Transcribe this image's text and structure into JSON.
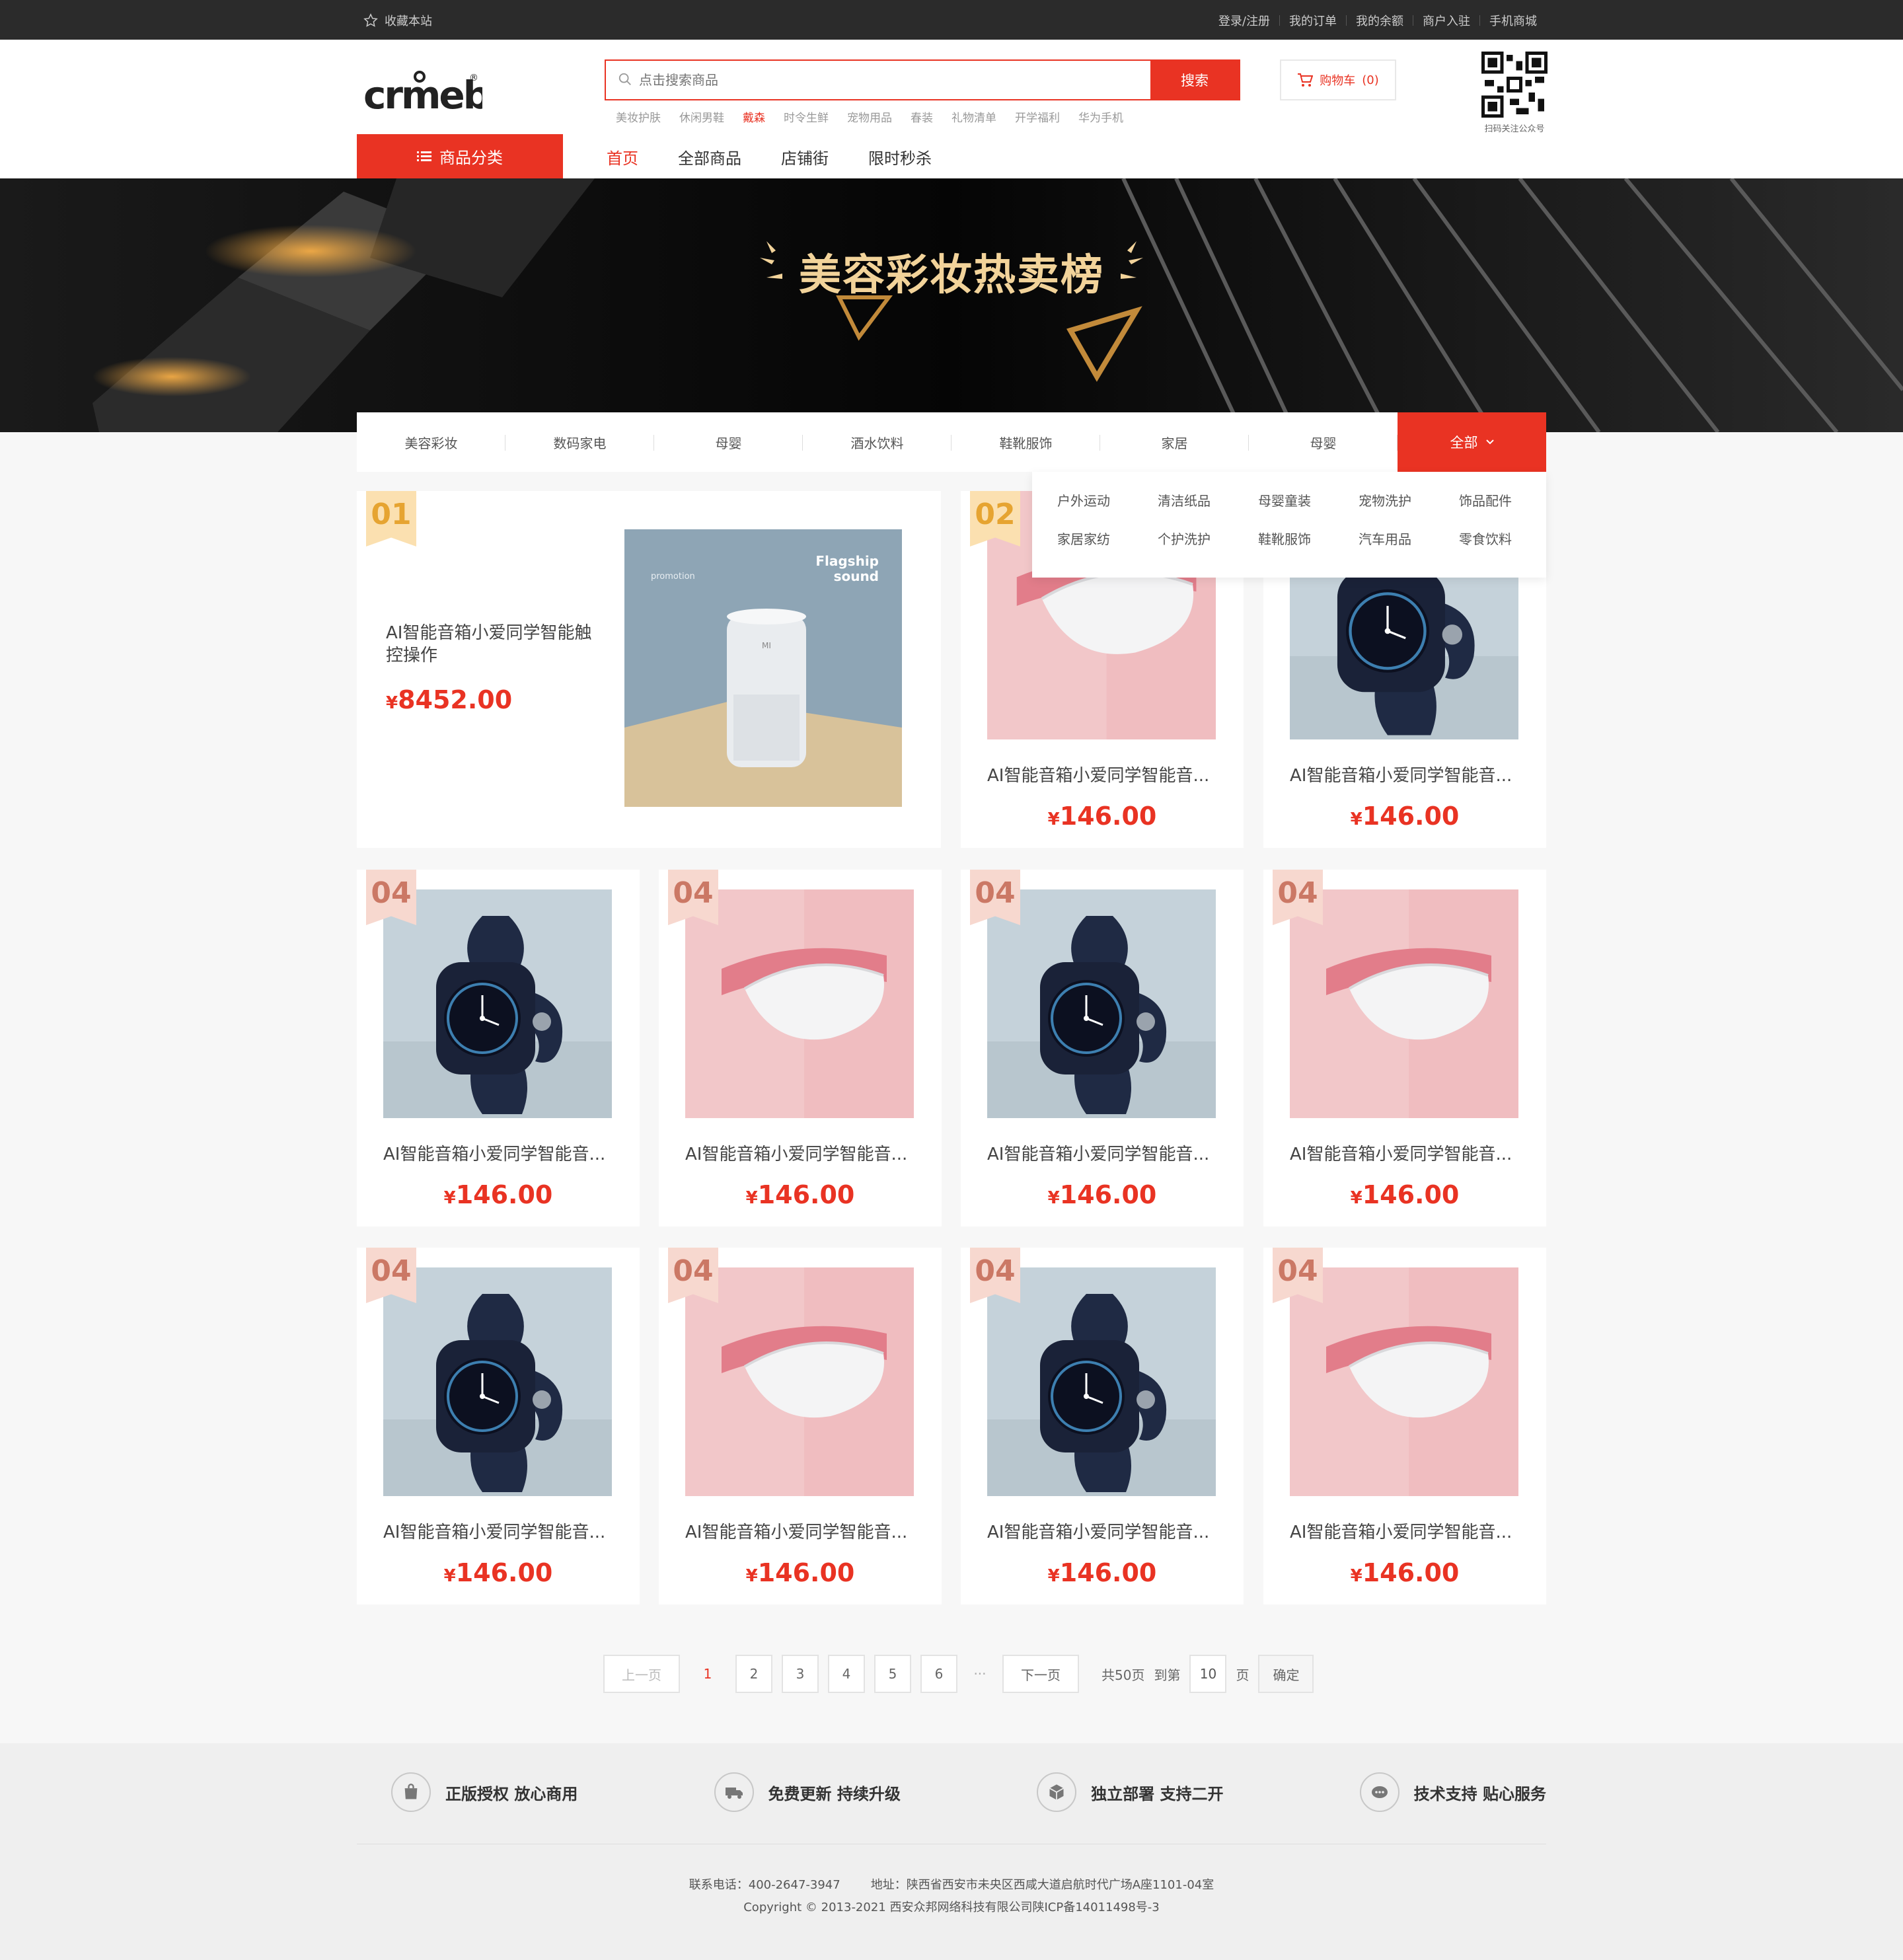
{
  "topbar": {
    "favorite": "收藏本站",
    "links": [
      "登录/注册",
      "我的订单",
      "我的余额",
      "商户入驻",
      "手机商城"
    ]
  },
  "header": {
    "logo_text": "crmeb",
    "search": {
      "placeholder": "点击搜索商品",
      "button": "搜索"
    },
    "hot_words": [
      "美妆护肤",
      "休闲男鞋",
      "戴森",
      "时令生鲜",
      "宠物用品",
      "春装",
      "礼物清单",
      "开学福利",
      "华为手机"
    ],
    "hot_active": "戴森",
    "cart": {
      "label": "购物车",
      "count": "(0)"
    },
    "qr_caption": "扫码关注公众号"
  },
  "nav": {
    "category_button": "商品分类",
    "items": [
      "首页",
      "全部商品",
      "店铺街",
      "限时秒杀"
    ],
    "active": "首页"
  },
  "banner": {
    "title": "美容彩妆热卖榜"
  },
  "category_tabs": {
    "items": [
      "美容彩妆",
      "数码家电",
      "母婴",
      "酒水饮料",
      "鞋靴服饰",
      "家居",
      "母婴"
    ],
    "all_label": "全部"
  },
  "dropdown": {
    "items": [
      "户外运动",
      "清洁纸品",
      "母婴童装",
      "宠物洗护",
      "饰品配件",
      "家居家纺",
      "个护洗护",
      "鞋靴服饰",
      "汽车用品",
      "零食饮料"
    ]
  },
  "featured": {
    "rank": "01",
    "title": "AI智能音箱小爱同学智能触控操作",
    "currency": "¥",
    "price": "8452.00",
    "image_text": {
      "brand": "Flagship",
      "sub": "sound",
      "promo": "promotion",
      "mi": "MI"
    }
  },
  "products": [
    {
      "rank": "02",
      "title": "AI智能音箱小爱同学智能音...",
      "currency": "¥",
      "price": "146.00",
      "image": "massager",
      "rank_style": "gold"
    },
    {
      "rank": "",
      "title": "AI智能音箱小爱同学智能音...",
      "currency": "¥",
      "price": "146.00",
      "image": "watch",
      "rank_style": "none"
    },
    {
      "rank": "04",
      "title": "AI智能音箱小爱同学智能音...",
      "currency": "¥",
      "price": "146.00",
      "image": "watch",
      "rank_style": "pink"
    },
    {
      "rank": "04",
      "title": "AI智能音箱小爱同学智能音...",
      "currency": "¥",
      "price": "146.00",
      "image": "massager",
      "rank_style": "pink"
    },
    {
      "rank": "04",
      "title": "AI智能音箱小爱同学智能音...",
      "currency": "¥",
      "price": "146.00",
      "image": "watch",
      "rank_style": "pink"
    },
    {
      "rank": "04",
      "title": "AI智能音箱小爱同学智能音...",
      "currency": "¥",
      "price": "146.00",
      "image": "massager",
      "rank_style": "pink"
    },
    {
      "rank": "04",
      "title": "AI智能音箱小爱同学智能音...",
      "currency": "¥",
      "price": "146.00",
      "image": "watch",
      "rank_style": "pink"
    },
    {
      "rank": "04",
      "title": "AI智能音箱小爱同学智能音...",
      "currency": "¥",
      "price": "146.00",
      "image": "massager",
      "rank_style": "pink"
    },
    {
      "rank": "04",
      "title": "AI智能音箱小爱同学智能音...",
      "currency": "¥",
      "price": "146.00",
      "image": "watch",
      "rank_style": "pink"
    },
    {
      "rank": "04",
      "title": "AI智能音箱小爱同学智能音...",
      "currency": "¥",
      "price": "146.00",
      "image": "massager",
      "rank_style": "pink"
    }
  ],
  "pagination": {
    "prev": "上一页",
    "current": "1",
    "pages": [
      "2",
      "3",
      "4",
      "5",
      "6"
    ],
    "dots": "···",
    "next": "下一页",
    "total": "共50页",
    "goto": "到第",
    "goto_value": "10",
    "page_unit": "页",
    "confirm": "确定"
  },
  "footer": {
    "features": [
      {
        "icon": "bag-icon",
        "label": "正版授权 放心商用"
      },
      {
        "icon": "truck-icon",
        "label": "免费更新 持续升级"
      },
      {
        "icon": "box-icon",
        "label": "独立部署 支持二开"
      },
      {
        "icon": "support-icon",
        "label": "技术支持 贴心服务"
      }
    ],
    "phone": "联系电话：400-2647-3947",
    "address": "地址：陕西省西安市未央区西咸大道启航时代广场A座1101-04室",
    "copyright": "Copyright © 2013-2021 西安众邦网络科技有限公司陕ICP备14011498号-3"
  },
  "colors": {
    "accent": "#e93323",
    "topbar": "#2b2b2b",
    "banner_text": "#f2d39a"
  }
}
